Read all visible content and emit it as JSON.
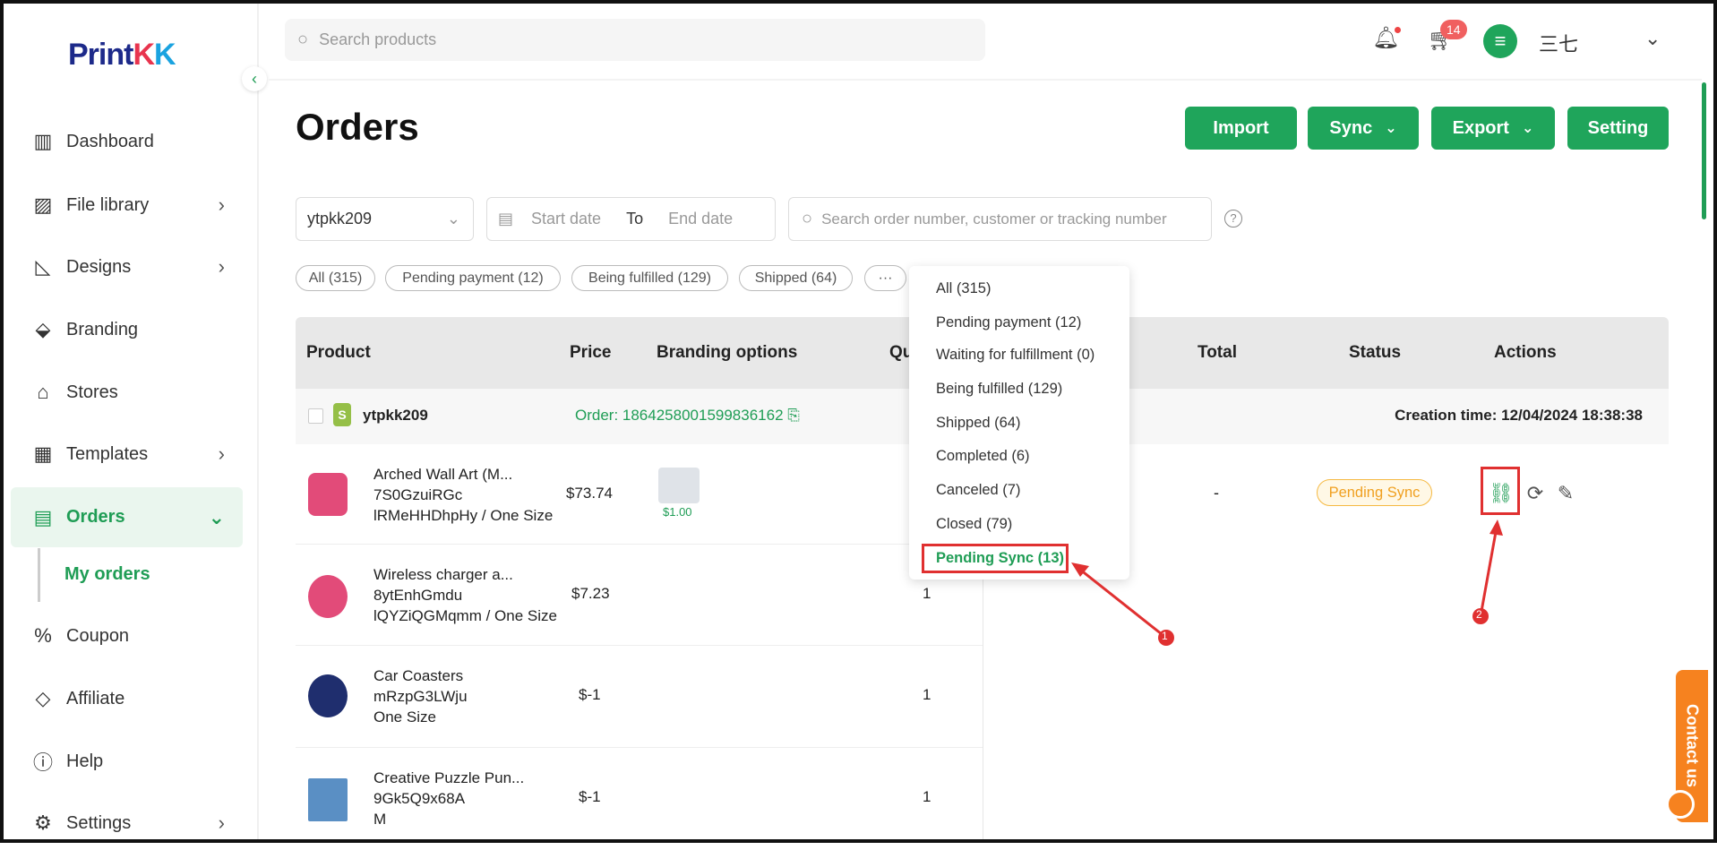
{
  "brand": {
    "logo_text": "PrintKK"
  },
  "topbar": {
    "search_placeholder": "Search products",
    "cart_count": "14",
    "user_name": "三七"
  },
  "sidebar": {
    "items": [
      {
        "label": "Dashboard",
        "icon": "dashboard-icon"
      },
      {
        "label": "File library",
        "icon": "image-icon"
      },
      {
        "label": "Designs",
        "icon": "ruler-icon"
      },
      {
        "label": "Branding",
        "icon": "tag-icon"
      },
      {
        "label": "Stores",
        "icon": "store-icon"
      },
      {
        "label": "Templates",
        "icon": "layout-icon"
      },
      {
        "label": "Orders",
        "icon": "order-icon"
      },
      {
        "label": "Coupon",
        "icon": "coupon-icon"
      },
      {
        "label": "Affiliate",
        "icon": "handshake-icon"
      },
      {
        "label": "Help",
        "icon": "help-icon"
      },
      {
        "label": "Settings",
        "icon": "gear-icon"
      }
    ],
    "sub_item": "My orders"
  },
  "page": {
    "title": "Orders"
  },
  "actions": {
    "import": "Import",
    "sync": "Sync",
    "export": "Export",
    "setting": "Setting"
  },
  "filters": {
    "store_value": "ytpkk209",
    "start_placeholder": "Start date",
    "to_label": "To",
    "end_placeholder": "End date",
    "search_placeholder": "Search order number, customer or tracking number"
  },
  "chips": [
    "All (315)",
    "Pending payment (12)",
    "Being fulfilled (129)",
    "Shipped (64)",
    "···"
  ],
  "dropdown": [
    "All (315)",
    "Pending payment (12)",
    "Waiting for fulfillment (0)",
    "Being fulfilled (129)",
    "Shipped (64)",
    "Completed (6)",
    "Canceled (7)",
    "Closed (79)",
    "Pending Sync (13)"
  ],
  "table": {
    "headers": {
      "product": "Product",
      "price": "Price",
      "branding": "Branding options",
      "qty": "Qu",
      "total": "Total",
      "status": "Status",
      "actions": "Actions"
    },
    "order": {
      "store": "ytpkk209",
      "order_label": "Order: 1864258001599836162",
      "creation": "Creation time: 12/04/2024 18:38:38",
      "total": "-",
      "status": "Pending Sync",
      "branding_price": "$1.00"
    },
    "rows": [
      {
        "name": "Arched Wall Art (M...",
        "sku": "7S0GzuiRGc",
        "variant": "lRMeHHDhpHy / One Size",
        "price": "$73.74",
        "qty": ""
      },
      {
        "name": "Wireless charger a...",
        "sku": "8ytEnhGmdu",
        "variant": "lQYZiQGMqmm / One Size",
        "price": "$7.23",
        "qty": "1"
      },
      {
        "name": "Car Coasters",
        "sku": "mRzpG3LWju",
        "variant": "One Size",
        "price": "$-1",
        "qty": "1"
      },
      {
        "name": "Creative Puzzle Pun...",
        "sku": "9Gk5Q9x68A",
        "variant": "M",
        "price": "$-1",
        "qty": "1"
      }
    ]
  },
  "annotations": {
    "step1": "1",
    "step2": "2"
  },
  "contact": "Contact us",
  "colors": {
    "accent": "#1fa55b",
    "highlight": "#e03030",
    "pending": "#f0a020",
    "contact": "#f6821f"
  }
}
